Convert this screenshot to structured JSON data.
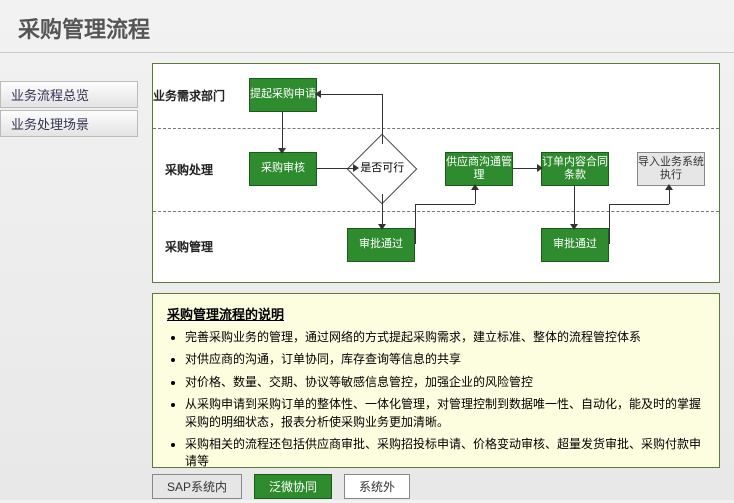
{
  "title": "采购管理流程",
  "sidebar": {
    "items": [
      {
        "label": "业务流程总览"
      },
      {
        "label": "业务处理场景"
      }
    ]
  },
  "lanes": {
    "l1": "业务需求部门",
    "l2": "采购处理",
    "l3": "采购管理"
  },
  "nodes": {
    "n1": "提起采购申请",
    "n2": "采购审核",
    "n3": "是否可行",
    "n4": "供应商沟通管理",
    "n5": "订单内容合同条款",
    "n6": "导入业务系统执行",
    "n7": "审批通过",
    "n8": "审批通过"
  },
  "desc": {
    "title": "采购管理流程的说明",
    "items": [
      "完善采购业务的管理，通过网络的方式提起采购需求，建立标准、整体的流程管控体系",
      "对供应商的沟通，订单协同，库存查询等信息的共享",
      "对价格、数量、交期、协议等敏感信息管控，加强企业的风险管控",
      "从采购申请到采购订单的整体性、一体化管理，对管理控制到数据唯一性、自动化，能及时的掌握采购的明细状态，报表分析使采购业务更加清晰。",
      "采购相关的流程还包括供应商审批、采购招投标申请、价格变动审核、超量发货审批、采购付款申请等"
    ]
  },
  "legend": {
    "a": "SAP系统内",
    "b": "泛微协同",
    "c": "系统外"
  }
}
